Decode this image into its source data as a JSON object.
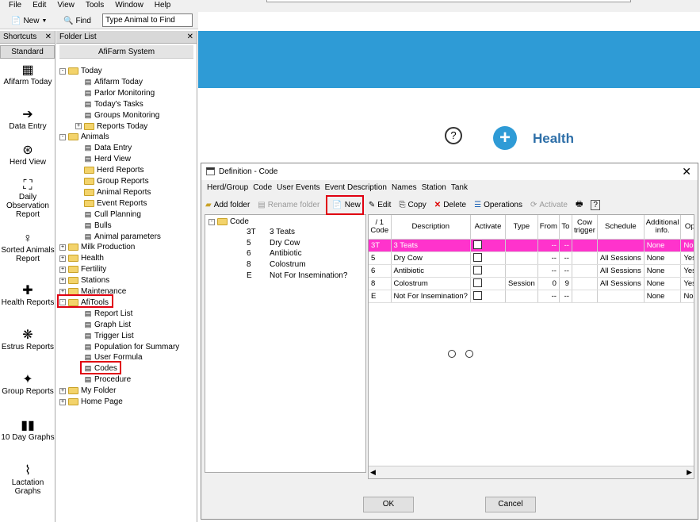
{
  "menu": [
    "File",
    "Edit",
    "View",
    "Tools",
    "Window",
    "Help"
  ],
  "toolbar": {
    "new_label": "New",
    "find_label": "Find",
    "find_placeholder": "Type Animal to Find"
  },
  "shortcuts": {
    "header": "Shortcuts",
    "standard": "Standard",
    "items": [
      {
        "label": "Afifarm Today",
        "icon": "calendar-icon"
      },
      {
        "label": "Data Entry",
        "icon": "data-entry-icon"
      },
      {
        "label": "Herd View",
        "icon": "herd-view-icon"
      },
      {
        "label": "Daily Observation Report",
        "icon": "observation-icon"
      },
      {
        "label": "Sorted Animals Report",
        "icon": "sorted-animals-icon"
      },
      {
        "label": "Health Reports",
        "icon": "health-reports-icon"
      },
      {
        "label": "Estrus Reports",
        "icon": "estrus-reports-icon"
      },
      {
        "label": "Group Reports",
        "icon": "group-reports-icon"
      },
      {
        "label": "10 Day Graphs",
        "icon": "graph-icon"
      },
      {
        "label": "Lactation Graphs",
        "icon": "lactation-graph-icon"
      }
    ]
  },
  "folders": {
    "header": "Folder List",
    "title": "AfiFarm System",
    "tree": [
      {
        "label": "Today",
        "level": 0,
        "type": "folder-open",
        "toggle": "-"
      },
      {
        "label": "Afifarm Today",
        "level": 1,
        "type": "item"
      },
      {
        "label": "Parlor Monitoring",
        "level": 1,
        "type": "item"
      },
      {
        "label": "Today's Tasks",
        "level": 1,
        "type": "item"
      },
      {
        "label": "Groups Monitoring",
        "level": 1,
        "type": "item"
      },
      {
        "label": "Reports Today",
        "level": 1,
        "type": "folder",
        "toggle": "+"
      },
      {
        "label": "Animals",
        "level": 0,
        "type": "folder-open",
        "toggle": "-"
      },
      {
        "label": "Data Entry",
        "level": 1,
        "type": "item"
      },
      {
        "label": "Herd View",
        "level": 1,
        "type": "item"
      },
      {
        "label": "Herd Reports",
        "level": 1,
        "type": "folder"
      },
      {
        "label": "Group Reports",
        "level": 1,
        "type": "folder"
      },
      {
        "label": "Animal Reports",
        "level": 1,
        "type": "folder"
      },
      {
        "label": "Event Reports",
        "level": 1,
        "type": "folder"
      },
      {
        "label": "Cull Planning",
        "level": 1,
        "type": "item"
      },
      {
        "label": "Bulls",
        "level": 1,
        "type": "item"
      },
      {
        "label": "Animal parameters",
        "level": 1,
        "type": "item"
      },
      {
        "label": "Milk Production",
        "level": 0,
        "type": "folder",
        "toggle": "+"
      },
      {
        "label": "Health",
        "level": 0,
        "type": "folder",
        "toggle": "+"
      },
      {
        "label": "Fertility",
        "level": 0,
        "type": "folder",
        "toggle": "+"
      },
      {
        "label": "Stations",
        "level": 0,
        "type": "folder",
        "toggle": "+"
      },
      {
        "label": "Maintenance",
        "level": 0,
        "type": "folder",
        "toggle": "+"
      },
      {
        "label": "AfiTools",
        "level": 0,
        "type": "folder-open",
        "toggle": "-"
      },
      {
        "label": "Report List",
        "level": 1,
        "type": "item"
      },
      {
        "label": "Graph List",
        "level": 1,
        "type": "item"
      },
      {
        "label": "Trigger List",
        "level": 1,
        "type": "item"
      },
      {
        "label": "Population for Summary",
        "level": 1,
        "type": "item"
      },
      {
        "label": "User Formula",
        "level": 1,
        "type": "item"
      },
      {
        "label": "Codes",
        "level": 1,
        "type": "item"
      },
      {
        "label": "Procedure",
        "level": 1,
        "type": "item"
      },
      {
        "label": "My Folder",
        "level": 0,
        "type": "folder",
        "toggle": "+"
      },
      {
        "label": "Home Page",
        "level": 0,
        "type": "folder",
        "toggle": "+"
      }
    ]
  },
  "health_title": "Health",
  "dialog": {
    "title": "Definition - Code",
    "menu": [
      "Herd/Group",
      "Code",
      "User Events",
      "Event Description",
      "Names",
      "Station",
      "Tank"
    ],
    "tools": {
      "add_folder": "Add folder",
      "rename_folder": "Rename folder",
      "new": "New",
      "edit": "Edit",
      "copy": "Copy",
      "delete": "Delete",
      "operations": "Operations",
      "activate": "Activate"
    },
    "tree_root": "Code",
    "tree_items": [
      {
        "code": "3T",
        "name": "3 Teats"
      },
      {
        "code": "5",
        "name": "Dry Cow"
      },
      {
        "code": "6",
        "name": "Antibiotic"
      },
      {
        "code": "8",
        "name": "Colostrum"
      },
      {
        "code": "E",
        "name": "Not For Insemination?"
      }
    ],
    "columns": [
      "/ 1 Code",
      "Description",
      "Activate",
      "Type",
      "From",
      "To",
      "Cow trigger",
      "Schedule",
      "Additional info.",
      "Op"
    ],
    "rows": [
      {
        "code": "3T",
        "desc": "3 Teats",
        "type": "",
        "from": "--",
        "to": "--",
        "trig": "",
        "sched": "",
        "info": "None",
        "op": "No"
      },
      {
        "code": "5",
        "desc": "Dry Cow",
        "type": "",
        "from": "--",
        "to": "--",
        "trig": "",
        "sched": "All Sessions",
        "info": "None",
        "op": "Yes"
      },
      {
        "code": "6",
        "desc": "Antibiotic",
        "type": "",
        "from": "--",
        "to": "--",
        "trig": "",
        "sched": "All Sessions",
        "info": "None",
        "op": "Yes"
      },
      {
        "code": "8",
        "desc": "Colostrum",
        "type": "Session",
        "from": "0",
        "to": "9",
        "trig": "",
        "sched": "All Sessions",
        "info": "None",
        "op": "Yes"
      },
      {
        "code": "E",
        "desc": "Not For Insemination?",
        "type": "",
        "from": "--",
        "to": "--",
        "trig": "",
        "sched": "",
        "info": "None",
        "op": "No"
      }
    ],
    "ok": "OK",
    "cancel": "Cancel"
  }
}
